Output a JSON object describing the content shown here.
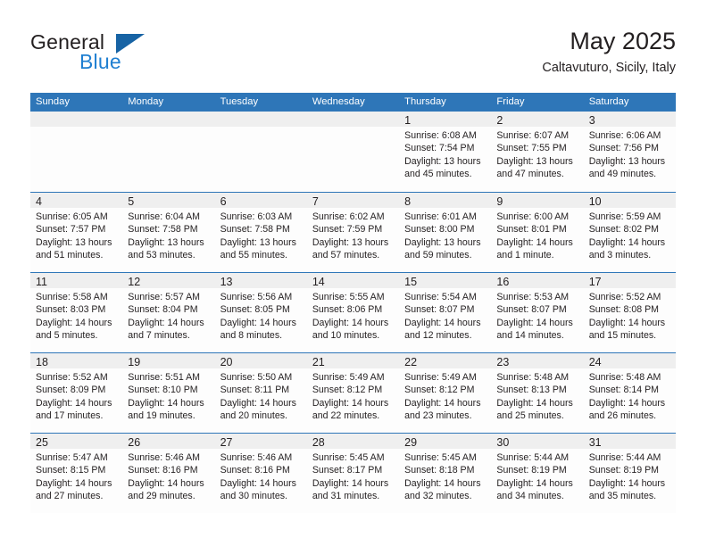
{
  "brand": {
    "name_part1": "General",
    "name_part2": "Blue",
    "logo_icon": "triangle-logo-icon"
  },
  "header": {
    "title": "May 2025",
    "subtitle": "Caltavuturo, Sicily, Italy"
  },
  "colors": {
    "header_blue": "#2E76B8",
    "row_band_gray": "#EFEFEF",
    "brand_blue": "#1F7FD1",
    "brand_triangle": "#1763A4",
    "text": "#231F20"
  },
  "weekday_headers": [
    "Sunday",
    "Monday",
    "Tuesday",
    "Wednesday",
    "Thursday",
    "Friday",
    "Saturday"
  ],
  "weeks": [
    [
      {
        "day": "",
        "sunrise": "",
        "sunset": "",
        "daylight1": "",
        "daylight2": "",
        "empty": true
      },
      {
        "day": "",
        "sunrise": "",
        "sunset": "",
        "daylight1": "",
        "daylight2": "",
        "empty": true
      },
      {
        "day": "",
        "sunrise": "",
        "sunset": "",
        "daylight1": "",
        "daylight2": "",
        "empty": true
      },
      {
        "day": "",
        "sunrise": "",
        "sunset": "",
        "daylight1": "",
        "daylight2": "",
        "empty": true
      },
      {
        "day": "1",
        "sunrise": "Sunrise: 6:08 AM",
        "sunset": "Sunset: 7:54 PM",
        "daylight1": "Daylight: 13 hours",
        "daylight2": "and 45 minutes.",
        "empty": false
      },
      {
        "day": "2",
        "sunrise": "Sunrise: 6:07 AM",
        "sunset": "Sunset: 7:55 PM",
        "daylight1": "Daylight: 13 hours",
        "daylight2": "and 47 minutes.",
        "empty": false
      },
      {
        "day": "3",
        "sunrise": "Sunrise: 6:06 AM",
        "sunset": "Sunset: 7:56 PM",
        "daylight1": "Daylight: 13 hours",
        "daylight2": "and 49 minutes.",
        "empty": false
      }
    ],
    [
      {
        "day": "4",
        "sunrise": "Sunrise: 6:05 AM",
        "sunset": "Sunset: 7:57 PM",
        "daylight1": "Daylight: 13 hours",
        "daylight2": "and 51 minutes.",
        "empty": false
      },
      {
        "day": "5",
        "sunrise": "Sunrise: 6:04 AM",
        "sunset": "Sunset: 7:58 PM",
        "daylight1": "Daylight: 13 hours",
        "daylight2": "and 53 minutes.",
        "empty": false
      },
      {
        "day": "6",
        "sunrise": "Sunrise: 6:03 AM",
        "sunset": "Sunset: 7:58 PM",
        "daylight1": "Daylight: 13 hours",
        "daylight2": "and 55 minutes.",
        "empty": false
      },
      {
        "day": "7",
        "sunrise": "Sunrise: 6:02 AM",
        "sunset": "Sunset: 7:59 PM",
        "daylight1": "Daylight: 13 hours",
        "daylight2": "and 57 minutes.",
        "empty": false
      },
      {
        "day": "8",
        "sunrise": "Sunrise: 6:01 AM",
        "sunset": "Sunset: 8:00 PM",
        "daylight1": "Daylight: 13 hours",
        "daylight2": "and 59 minutes.",
        "empty": false
      },
      {
        "day": "9",
        "sunrise": "Sunrise: 6:00 AM",
        "sunset": "Sunset: 8:01 PM",
        "daylight1": "Daylight: 14 hours",
        "daylight2": "and 1 minute.",
        "empty": false
      },
      {
        "day": "10",
        "sunrise": "Sunrise: 5:59 AM",
        "sunset": "Sunset: 8:02 PM",
        "daylight1": "Daylight: 14 hours",
        "daylight2": "and 3 minutes.",
        "empty": false
      }
    ],
    [
      {
        "day": "11",
        "sunrise": "Sunrise: 5:58 AM",
        "sunset": "Sunset: 8:03 PM",
        "daylight1": "Daylight: 14 hours",
        "daylight2": "and 5 minutes.",
        "empty": false
      },
      {
        "day": "12",
        "sunrise": "Sunrise: 5:57 AM",
        "sunset": "Sunset: 8:04 PM",
        "daylight1": "Daylight: 14 hours",
        "daylight2": "and 7 minutes.",
        "empty": false
      },
      {
        "day": "13",
        "sunrise": "Sunrise: 5:56 AM",
        "sunset": "Sunset: 8:05 PM",
        "daylight1": "Daylight: 14 hours",
        "daylight2": "and 8 minutes.",
        "empty": false
      },
      {
        "day": "14",
        "sunrise": "Sunrise: 5:55 AM",
        "sunset": "Sunset: 8:06 PM",
        "daylight1": "Daylight: 14 hours",
        "daylight2": "and 10 minutes.",
        "empty": false
      },
      {
        "day": "15",
        "sunrise": "Sunrise: 5:54 AM",
        "sunset": "Sunset: 8:07 PM",
        "daylight1": "Daylight: 14 hours",
        "daylight2": "and 12 minutes.",
        "empty": false
      },
      {
        "day": "16",
        "sunrise": "Sunrise: 5:53 AM",
        "sunset": "Sunset: 8:07 PM",
        "daylight1": "Daylight: 14 hours",
        "daylight2": "and 14 minutes.",
        "empty": false
      },
      {
        "day": "17",
        "sunrise": "Sunrise: 5:52 AM",
        "sunset": "Sunset: 8:08 PM",
        "daylight1": "Daylight: 14 hours",
        "daylight2": "and 15 minutes.",
        "empty": false
      }
    ],
    [
      {
        "day": "18",
        "sunrise": "Sunrise: 5:52 AM",
        "sunset": "Sunset: 8:09 PM",
        "daylight1": "Daylight: 14 hours",
        "daylight2": "and 17 minutes.",
        "empty": false
      },
      {
        "day": "19",
        "sunrise": "Sunrise: 5:51 AM",
        "sunset": "Sunset: 8:10 PM",
        "daylight1": "Daylight: 14 hours",
        "daylight2": "and 19 minutes.",
        "empty": false
      },
      {
        "day": "20",
        "sunrise": "Sunrise: 5:50 AM",
        "sunset": "Sunset: 8:11 PM",
        "daylight1": "Daylight: 14 hours",
        "daylight2": "and 20 minutes.",
        "empty": false
      },
      {
        "day": "21",
        "sunrise": "Sunrise: 5:49 AM",
        "sunset": "Sunset: 8:12 PM",
        "daylight1": "Daylight: 14 hours",
        "daylight2": "and 22 minutes.",
        "empty": false
      },
      {
        "day": "22",
        "sunrise": "Sunrise: 5:49 AM",
        "sunset": "Sunset: 8:12 PM",
        "daylight1": "Daylight: 14 hours",
        "daylight2": "and 23 minutes.",
        "empty": false
      },
      {
        "day": "23",
        "sunrise": "Sunrise: 5:48 AM",
        "sunset": "Sunset: 8:13 PM",
        "daylight1": "Daylight: 14 hours",
        "daylight2": "and 25 minutes.",
        "empty": false
      },
      {
        "day": "24",
        "sunrise": "Sunrise: 5:48 AM",
        "sunset": "Sunset: 8:14 PM",
        "daylight1": "Daylight: 14 hours",
        "daylight2": "and 26 minutes.",
        "empty": false
      }
    ],
    [
      {
        "day": "25",
        "sunrise": "Sunrise: 5:47 AM",
        "sunset": "Sunset: 8:15 PM",
        "daylight1": "Daylight: 14 hours",
        "daylight2": "and 27 minutes.",
        "empty": false
      },
      {
        "day": "26",
        "sunrise": "Sunrise: 5:46 AM",
        "sunset": "Sunset: 8:16 PM",
        "daylight1": "Daylight: 14 hours",
        "daylight2": "and 29 minutes.",
        "empty": false
      },
      {
        "day": "27",
        "sunrise": "Sunrise: 5:46 AM",
        "sunset": "Sunset: 8:16 PM",
        "daylight1": "Daylight: 14 hours",
        "daylight2": "and 30 minutes.",
        "empty": false
      },
      {
        "day": "28",
        "sunrise": "Sunrise: 5:45 AM",
        "sunset": "Sunset: 8:17 PM",
        "daylight1": "Daylight: 14 hours",
        "daylight2": "and 31 minutes.",
        "empty": false
      },
      {
        "day": "29",
        "sunrise": "Sunrise: 5:45 AM",
        "sunset": "Sunset: 8:18 PM",
        "daylight1": "Daylight: 14 hours",
        "daylight2": "and 32 minutes.",
        "empty": false
      },
      {
        "day": "30",
        "sunrise": "Sunrise: 5:44 AM",
        "sunset": "Sunset: 8:19 PM",
        "daylight1": "Daylight: 14 hours",
        "daylight2": "and 34 minutes.",
        "empty": false
      },
      {
        "day": "31",
        "sunrise": "Sunrise: 5:44 AM",
        "sunset": "Sunset: 8:19 PM",
        "daylight1": "Daylight: 14 hours",
        "daylight2": "and 35 minutes.",
        "empty": false
      }
    ]
  ]
}
